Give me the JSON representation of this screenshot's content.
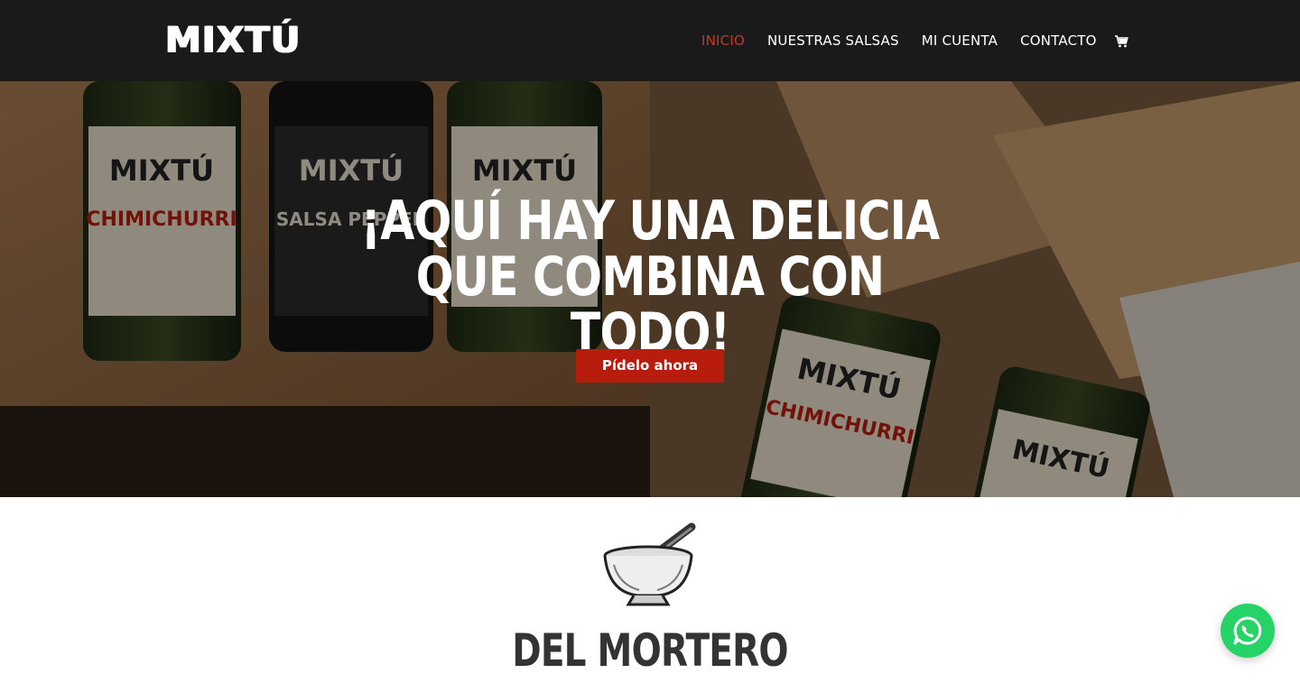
{
  "header": {
    "logo_text": "MIXTÚ",
    "nav": [
      {
        "label": "INICIO",
        "active": true
      },
      {
        "label": "NUESTRAS SALSAS",
        "active": false
      },
      {
        "label": "MI CUENTA",
        "active": false
      },
      {
        "label": "CONTACTO",
        "active": false
      }
    ],
    "cart_icon": "shopping-cart-icon"
  },
  "hero": {
    "title_line1": "¡AQUÍ HAY UNA DELICIA",
    "title_line2": "QUE COMBINA CON TODO!",
    "cta_label": "Pídelo ahora",
    "cta_color": "#b71c0c",
    "jar_labels": [
      {
        "brand": "MIXTÚ",
        "name": "CHIMICHURRI"
      },
      {
        "brand": "MIXTÚ",
        "name": "SALSA PEPPER"
      },
      {
        "brand": "MIXTÚ",
        "name": "CHIMICHURRI"
      },
      {
        "brand": "MIXTÚ",
        "name": "CHIMICHURRI"
      },
      {
        "brand": "MIXTÚ",
        "name": ""
      }
    ]
  },
  "section": {
    "icon": "mortar-and-pestle-icon",
    "title": "DEL MORTERO"
  },
  "whatsapp": {
    "icon": "whatsapp-icon",
    "color": "#25d366"
  },
  "colors": {
    "header_bg": "#1a1a1a",
    "nav_active": "#c0392b",
    "title_dark": "#333333"
  }
}
